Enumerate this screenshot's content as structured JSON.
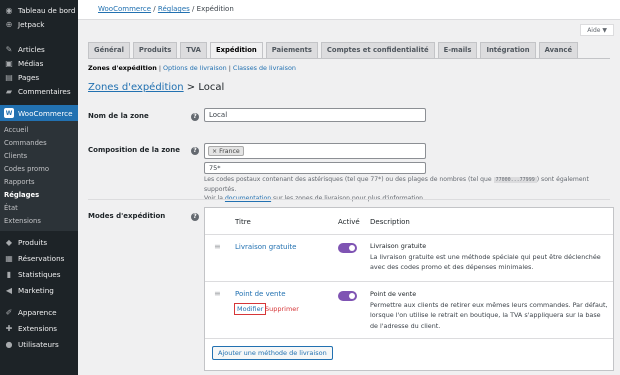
{
  "sidebar": {
    "top": [
      {
        "label": "Tableau de bord",
        "icon": "◉"
      },
      {
        "label": "Jetpack",
        "icon": "⊕"
      }
    ],
    "mid": [
      {
        "label": "Articles",
        "icon": "✎"
      },
      {
        "label": "Médias",
        "icon": "▣"
      },
      {
        "label": "Pages",
        "icon": "▤"
      },
      {
        "label": "Commentaires",
        "icon": "▰"
      }
    ],
    "woo": {
      "label": "WooCommerce",
      "icon": "W"
    },
    "woo_sub": [
      "Accueil",
      "Commandes",
      "Clients",
      "Codes promo",
      "Rapports",
      "Réglages",
      "État",
      "Extensions"
    ],
    "bottom": [
      {
        "label": "Produits",
        "icon": "◆"
      },
      {
        "label": "Réservations",
        "icon": "▦"
      },
      {
        "label": "Statistiques",
        "icon": "▮"
      },
      {
        "label": "Marketing",
        "icon": "◀"
      },
      {
        "label": "Apparence",
        "icon": "✐"
      },
      {
        "label": "Extensions",
        "icon": "✚"
      },
      {
        "label": "Utilisateurs",
        "icon": "●"
      }
    ]
  },
  "breadcrumb": {
    "root": "WooCommerce",
    "sep": " / ",
    "mid": "Réglages",
    "current": "Expédition"
  },
  "help_label": "Aide ▼",
  "tabs": [
    "Général",
    "Produits",
    "TVA",
    "Expédition",
    "Paiements",
    "Comptes et confidentialité",
    "E-mails",
    "Intégration",
    "Avancé"
  ],
  "subnav": {
    "current": "Zones d'expédition",
    "links": [
      "Options de livraison",
      "Classes de livraison"
    ]
  },
  "heading": {
    "link": "Zones d'expédition",
    "rest": " > Local"
  },
  "form": {
    "zone_name_label": "Nom de la zone",
    "zone_name_value": "Local",
    "regions_label": "Composition de la zone",
    "region_chip": "× France",
    "postcode_value": "75*",
    "hint_pre": "Les codes postaux contenant des astérisques (tel que 77*) ou des plages de nombres (tel que ",
    "hint_code": "77000...77999",
    "hint_post": ") sont également supportés.",
    "hint2_pre": "Voir la ",
    "hint2_link": "documentation",
    "hint2_post": " sur les zones de livraison pour plus d'information.",
    "methods_label": "Modes d'expédition"
  },
  "methods_table": {
    "col_title": "Titre",
    "col_enabled": "Activé",
    "col_desc": "Description",
    "rows": [
      {
        "title": "Livraison gratuite",
        "desc_title": "Livraison gratuite",
        "desc": "La livraison gratuite est une méthode spéciale qui peut être déclenchée avec des codes promo et des dépenses minimales."
      },
      {
        "title": "Point de vente",
        "desc_title": "Point de vente",
        "desc": "Permettre aux clients de retirer eux mêmes leurs commandes. Par défaut, lorsque l'on utilise le retrait en boutique, la TVA s'appliquera sur la base de l'adresse du client."
      }
    ],
    "edit_label": "Modifier",
    "delete_label": "Supprimer",
    "add_button": "Ajouter une méthode de livraison"
  },
  "colors": {
    "accent": "#2271b1",
    "toggle_on": "#7f54b3",
    "sidebar": "#1d2327",
    "danger": "#d63638"
  }
}
